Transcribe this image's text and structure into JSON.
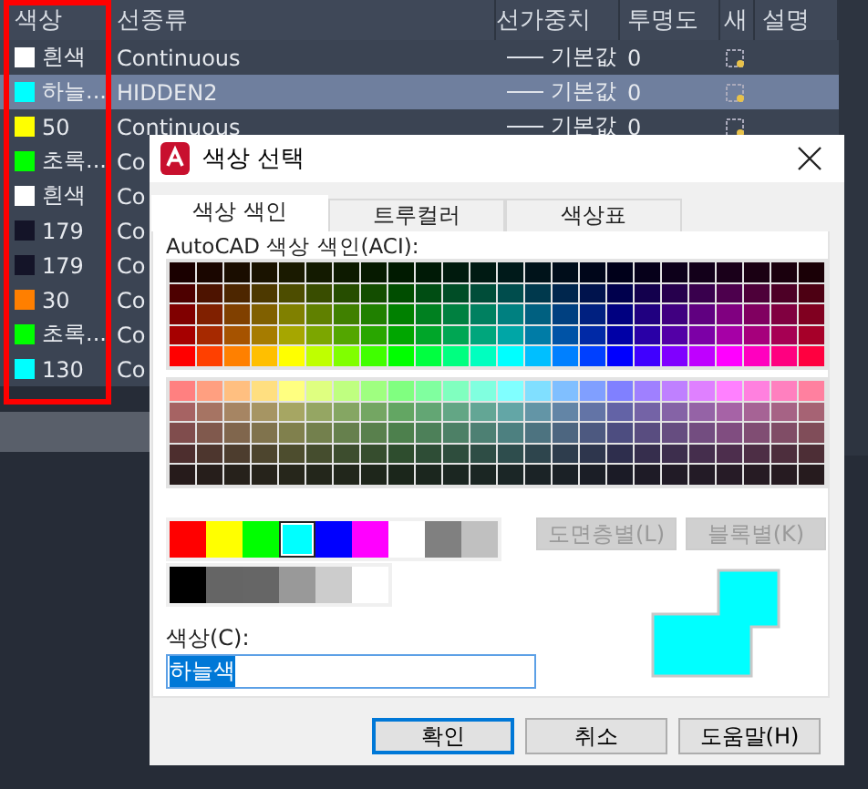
{
  "layer_table": {
    "columns": [
      "색상",
      "선종류",
      "선가중치",
      "투명도",
      "새",
      "설명"
    ],
    "rows": [
      {
        "color_name": "흰색",
        "color": "#ffffff",
        "linetype": "Continuous",
        "lineweight": "기본값",
        "transparency": "0",
        "selected": false
      },
      {
        "color_name": "하늘...",
        "color": "#00ffff",
        "linetype": "HIDDEN2",
        "lineweight": "기본값",
        "transparency": "0",
        "selected": true
      },
      {
        "color_name": "50",
        "color": "#ffff00",
        "linetype": "Continuous",
        "lineweight": "기본값",
        "transparency": "0",
        "selected": false
      },
      {
        "color_name": "초록...",
        "color": "#00ff00",
        "linetype": "Co",
        "selected": false
      },
      {
        "color_name": "흰색",
        "color": "#ffffff",
        "linetype": "Co",
        "selected": false
      },
      {
        "color_name": "179",
        "color": "#141428",
        "linetype": "Co",
        "selected": false
      },
      {
        "color_name": "179",
        "color": "#141428",
        "linetype": "Co",
        "selected": false
      },
      {
        "color_name": "30",
        "color": "#ff7f00",
        "linetype": "Co",
        "selected": false
      },
      {
        "color_name": "초록...",
        "color": "#00ff00",
        "linetype": "Co",
        "selected": false
      },
      {
        "color_name": "130",
        "color": "#00ffff",
        "linetype": "Co",
        "selected": false
      }
    ]
  },
  "dialog": {
    "title": "색상 선택",
    "tabs": [
      {
        "label": "색상 색인",
        "selected": true
      },
      {
        "label": "트루컬러",
        "selected": false
      },
      {
        "label": "색상표",
        "selected": false
      }
    ],
    "aci_label": "AutoCAD 색상 색인(ACI):",
    "standard_colors": [
      {
        "color": "#ff0000",
        "selected": false
      },
      {
        "color": "#ffff00",
        "selected": false
      },
      {
        "color": "#00ff00",
        "selected": false
      },
      {
        "color": "#00ffff",
        "selected": true
      },
      {
        "color": "#0000ff",
        "selected": false
      },
      {
        "color": "#ff00ff",
        "selected": false
      },
      {
        "color": "#ffffff",
        "selected": false
      },
      {
        "color": "#808080",
        "selected": false
      },
      {
        "color": "#c0c0c0",
        "selected": false
      }
    ],
    "gray_colors": [
      {
        "color": "#000000",
        "selected": false
      },
      {
        "color": "#656565",
        "selected": false
      },
      {
        "color": "#666666",
        "selected": false
      },
      {
        "color": "#999999",
        "selected": false
      },
      {
        "color": "#cccccc",
        "selected": false
      },
      {
        "color": "#ffffff",
        "selected": false
      }
    ],
    "side_buttons": [
      {
        "label": "도면층별(L)",
        "disabled": true
      },
      {
        "label": "블록별(K)",
        "disabled": true
      }
    ],
    "color_field": {
      "label": "색상(C):",
      "value": "하늘색"
    },
    "buttons": [
      {
        "label": "확인",
        "default": true
      },
      {
        "label": "취소",
        "default": false
      },
      {
        "label": "도움말(H)",
        "default": false
      }
    ]
  }
}
